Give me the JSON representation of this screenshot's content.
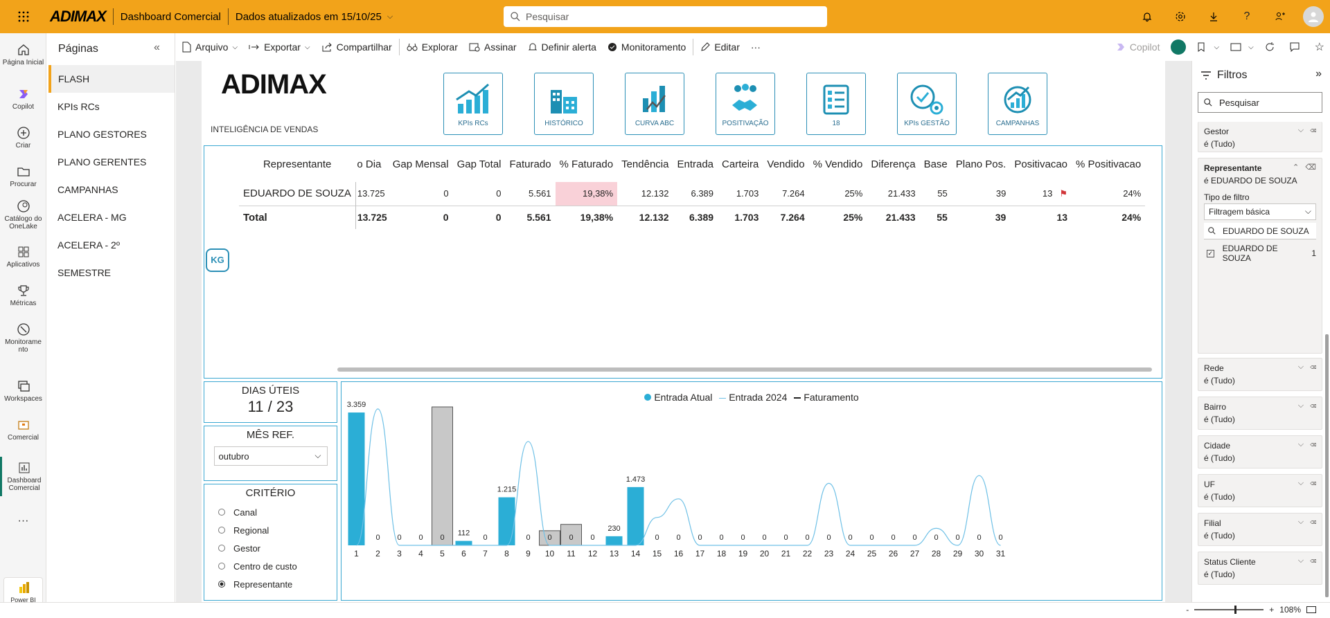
{
  "topbar": {
    "brand": "ADIMAX",
    "title": "Dashboard Comercial",
    "updated": "Dados atualizados em 15/10/25",
    "search_placeholder": "Pesquisar"
  },
  "rail": [
    {
      "label": "Página Inicial",
      "icon": "home-icon"
    },
    {
      "label": "Copilot",
      "icon": "copilot-icon"
    },
    {
      "label": "Criar",
      "icon": "plus-icon"
    },
    {
      "label": "Procurar",
      "icon": "folder-icon"
    },
    {
      "label": "Catálogo do OneLake",
      "icon": "onelake-icon"
    },
    {
      "label": "Aplicativos",
      "icon": "apps-icon"
    },
    {
      "label": "Métricas",
      "icon": "trophy-icon"
    },
    {
      "label": "Monitoramento",
      "icon": "monitor-icon"
    },
    {
      "label": "Workspaces",
      "icon": "workspaces-icon"
    },
    {
      "label": "Comercial",
      "icon": "comercial-icon"
    },
    {
      "label": "Dashboard Comercial",
      "icon": "dashboard-icon"
    },
    {
      "label": "Power BI",
      "icon": "powerbi-icon"
    }
  ],
  "pages": {
    "title": "Páginas",
    "items": [
      "FLASH",
      "KPIs RCs",
      "PLANO GESTORES",
      "PLANO GERENTES",
      "CAMPANHAS",
      "ACELERA - MG",
      "ACELERA - 2º SEMESTRE"
    ]
  },
  "toolbar": {
    "arquivo": "Arquivo",
    "exportar": "Exportar",
    "compartilhar": "Compartilhar",
    "explorar": "Explorar",
    "assinar": "Assinar",
    "alerta": "Definir alerta",
    "monitoramento": "Monitoramento",
    "editar": "Editar",
    "more": "···",
    "copilot": "Copilot"
  },
  "report": {
    "logo": "ADIMAX",
    "subtitle": "INTELIGÊNCIA DE VENDAS",
    "kg_badge": "KG",
    "nav": [
      "KPIs RCs",
      "HISTÓRICO",
      "CURVA ABC",
      "POSITIVAÇÃO",
      "18",
      "KPIs GESTÃO",
      "CAMPANHAS"
    ],
    "table": {
      "headers": [
        "Representante",
        "o Dia",
        "Gap Mensal",
        "Gap Total",
        "Faturado",
        "% Faturado",
        "Tendência",
        "Entrada",
        "Carteira",
        "Vendido",
        "% Vendido",
        "Diferença",
        "Base",
        "Plano Pos.",
        "Positivacao",
        "% Positivacao"
      ],
      "row": [
        "EDUARDO DE SOUZA",
        "13.725",
        "0",
        "0",
        "5.561",
        "19,38%",
        "12.132",
        "6.389",
        "1.703",
        "7.264",
        "25%",
        "21.433",
        "55",
        "39",
        "13",
        "24%"
      ],
      "total": [
        "Total",
        "13.725",
        "0",
        "0",
        "5.561",
        "19,38%",
        "12.132",
        "6.389",
        "1.703",
        "7.264",
        "25%",
        "21.433",
        "55",
        "39",
        "13",
        "24%"
      ]
    },
    "dias_uteis": {
      "label": "DIAS ÚTEIS",
      "value": "11 / 23"
    },
    "mes_ref": {
      "label": "MÊS REF.",
      "value": "outubro"
    },
    "criterio": {
      "label": "CRITÉRIO",
      "options": [
        "Canal",
        "Regional",
        "Gestor",
        "Centro de custo",
        "Representante"
      ],
      "selected": "Representante"
    }
  },
  "chart_data": {
    "type": "bar",
    "legend": [
      "Entrada Atual",
      "Entrada 2024",
      "Faturamento"
    ],
    "categories": [
      "1",
      "2",
      "3",
      "4",
      "5",
      "6",
      "7",
      "8",
      "9",
      "10",
      "11",
      "12",
      "13",
      "14",
      "15",
      "16",
      "17",
      "18",
      "19",
      "20",
      "21",
      "22",
      "23",
      "24",
      "25",
      "26",
      "27",
      "28",
      "29",
      "30",
      "31"
    ],
    "series": [
      {
        "name": "Entrada Atual",
        "values": [
          3359,
          0,
          0,
          0,
          0,
          112,
          0,
          1215,
          0,
          0,
          0,
          0,
          230,
          1473,
          0,
          0,
          0,
          0,
          0,
          0,
          0,
          0,
          0,
          0,
          0,
          0,
          0,
          0,
          0,
          0,
          0
        ]
      },
      {
        "name": "Faturamento",
        "values": [
          0,
          0,
          0,
          0,
          3500,
          0,
          0,
          0,
          0,
          370,
          530,
          0,
          0,
          0,
          0,
          0,
          0,
          0,
          0,
          0,
          0,
          0,
          0,
          0,
          0,
          0,
          0,
          0,
          0,
          0,
          0
        ]
      },
      {
        "name": "Entrada 2024",
        "values": [
          0,
          8800,
          0,
          0,
          0,
          0,
          0,
          0,
          6700,
          0,
          0,
          0,
          0,
          0,
          1800,
          3000,
          0,
          0,
          0,
          0,
          0,
          0,
          4000,
          0,
          0,
          0,
          0,
          1100,
          0,
          4500,
          0
        ]
      }
    ],
    "labels": [
      "3.359",
      "0",
      "0",
      "0",
      "0",
      "112",
      "0",
      "1.215",
      "0",
      "0",
      "0",
      "0",
      "230",
      "1.473",
      "0",
      "0",
      "0",
      "0",
      "0",
      "0",
      "0",
      "0",
      "0",
      "0",
      "0",
      "0",
      "0",
      "0",
      "0",
      "0",
      "0"
    ],
    "colors": {
      "atual": "#2baed6",
      "faturamento": "#c8c8c8",
      "entrada2024": "#6ec0e6"
    }
  },
  "filters": {
    "title": "Filtros",
    "search_placeholder": "Pesquisar",
    "cards": [
      {
        "name": "Gestor",
        "value": "é (Tudo)"
      },
      {
        "name": "Rede",
        "value": "é (Tudo)"
      },
      {
        "name": "Bairro",
        "value": "é (Tudo)"
      },
      {
        "name": "Cidade",
        "value": "é (Tudo)"
      },
      {
        "name": "UF",
        "value": "é (Tudo)"
      },
      {
        "name": "Filial",
        "value": "é (Tudo)"
      },
      {
        "name": "Status Cliente",
        "value": "é (Tudo)"
      }
    ],
    "representante": {
      "name": "Representante",
      "value": "é EDUARDO DE SOUZA",
      "tipo_label": "Tipo de filtro",
      "tipo_value": "Filtragem básica",
      "search": "EDUARDO DE SOUZA",
      "item": "EDUARDO DE SOUZA",
      "count": "1"
    }
  },
  "status": {
    "zoom": "108%",
    "minus": "-",
    "plus": "+"
  }
}
